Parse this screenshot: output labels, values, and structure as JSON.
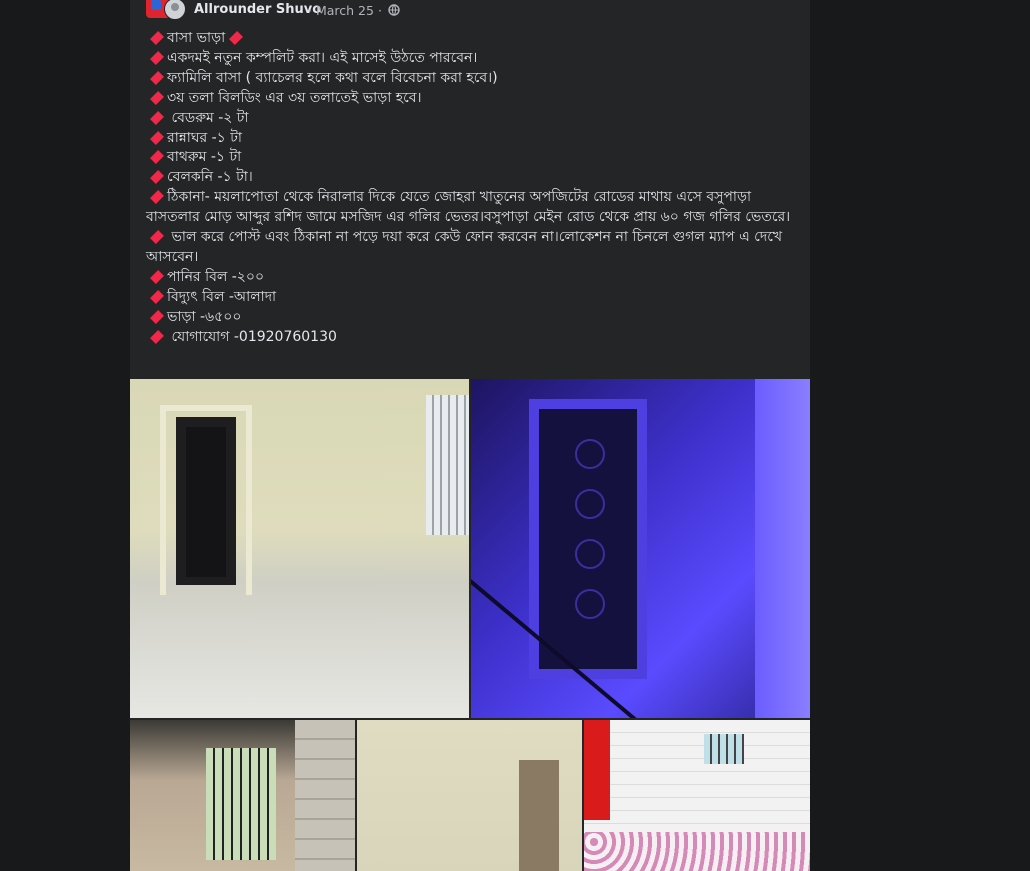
{
  "post": {
    "author": "Allrounder Shuvo",
    "sep1": "·",
    "date": "March 25",
    "sep2": "·",
    "more": "···",
    "lines": [
      "বাসা ভাড়া",
      "একদমই নতুন  কম্পলিট  করা। এই মাসেই উঠতে পারবেন।",
      "ফ্যামিলি বাসা ( ব্যাচেলর হলে কথা বলে  বিবেচনা করা হবে।)",
      "৩য় তলা বিলডিং এর ৩য় তলাতেই ভাড়া হবে।",
      " বেডরুম -২ টা",
      "রান্নাঘর -১ টা",
      "বাথরুম -১ টা",
      "বেলকনি -১ টা।",
      "ঠিকানা- ময়লাপোতা থেকে নিরালার দিকে যেতে জোহরা খাতুনের অপজিটের রোডের মাথায়   এসে বসুপাড়া বাসতলার   মোড় আব্দুর রশিদ জামে মসজিদ এর গলির ভেতর।বসুপাড়া  মেইন রোড থেকে প্রায় ৬০ গজ গলির ভেতরে।",
      " ভাল করে পোস্ট এবং  ঠিকানা না পড়ে দয়া করে কেউ ফোন করবেন না।লোকেশন না চিনলে গুগল ম্যাপ এ দেখে আসবেন।",
      "পানির বিল -২০০",
      "বিদ্যুৎ বিল -আলাদা",
      "ভাড়া -৬৫০০",
      " যোগাযোগ -01920760130"
    ]
  },
  "photos": [
    {
      "name": "room-with-door-photo"
    },
    {
      "name": "blue-lit-door-photo"
    },
    {
      "name": "kitchen-window-photo"
    },
    {
      "name": "empty-room-photo"
    },
    {
      "name": "bathroom-tiles-photo"
    }
  ],
  "colors": {
    "page_bg": "#18191a",
    "card_bg": "#242526",
    "text": "#e4e6eb",
    "meta": "#b0b3b8",
    "diamond": "#f02849"
  },
  "icons": [
    "globe-icon",
    "more-options-icon",
    "red-diamond-icon"
  ]
}
